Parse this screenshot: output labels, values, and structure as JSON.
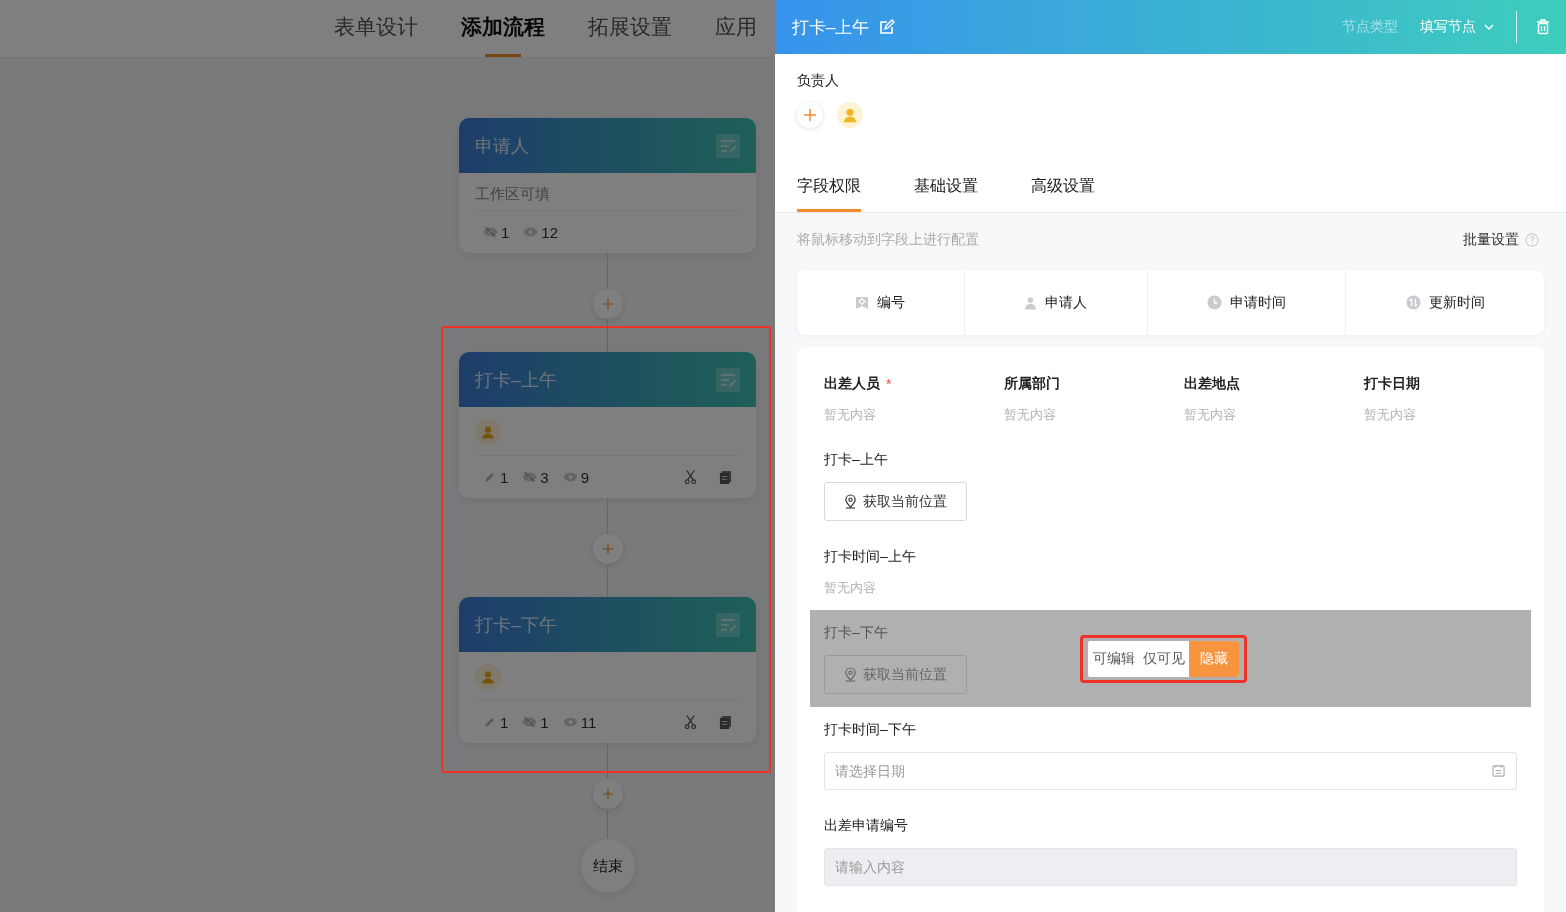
{
  "top_tabs": [
    {
      "label": "表单设计",
      "selected": false
    },
    {
      "label": "添加流程",
      "selected": true
    },
    {
      "label": "拓展设置",
      "selected": false
    },
    {
      "label": "应用",
      "selected": false
    }
  ],
  "flow": {
    "nodes": [
      {
        "kind": "start",
        "title": "申请人",
        "subtitle": "工作区可填",
        "counts": [
          {
            "kind": "hidden",
            "value": "1"
          },
          {
            "kind": "visible",
            "value": "12"
          }
        ]
      },
      {
        "kind": "task",
        "title": "打卡–上午",
        "counts": [
          {
            "kind": "editable",
            "value": "1"
          },
          {
            "kind": "hidden",
            "value": "3"
          },
          {
            "kind": "visible",
            "value": "9"
          }
        ]
      },
      {
        "kind": "task",
        "title": "打卡–下午",
        "counts": [
          {
            "kind": "editable",
            "value": "1"
          },
          {
            "kind": "hidden",
            "value": "1"
          },
          {
            "kind": "visible",
            "value": "11"
          }
        ]
      }
    ],
    "end_label": "结束"
  },
  "drawer": {
    "title": "打卡–上午",
    "node_type_label": "节点类型",
    "node_type": "填写节点",
    "assignee_label": "负责人",
    "tabs": [
      {
        "label": "字段权限",
        "selected": true
      },
      {
        "label": "基础设置",
        "selected": false
      },
      {
        "label": "高级设置",
        "selected": false
      }
    ],
    "hint": "将鼠标移动到字段上进行配置",
    "batch_label": "批量设置",
    "system_fields": [
      {
        "kind": "number",
        "label": "编号"
      },
      {
        "kind": "person",
        "label": "申请人"
      },
      {
        "kind": "created",
        "label": "申请时间"
      },
      {
        "kind": "updated",
        "label": "更新时间"
      }
    ],
    "rows": [
      {
        "hovered": false,
        "fields": [
          {
            "kind": "text",
            "label": "出差人员",
            "required_mark": "*",
            "value": "暂无内容"
          },
          {
            "kind": "text",
            "label": "所属部门",
            "value": "暂无内容"
          },
          {
            "kind": "text",
            "label": "出差地点",
            "value": "暂无内容"
          },
          {
            "kind": "text",
            "label": "打卡日期",
            "value": "暂无内容"
          }
        ]
      },
      {
        "hovered": false,
        "fields": [
          {
            "kind": "location",
            "label": "打卡–上午",
            "button": "获取当前位置"
          }
        ]
      },
      {
        "hovered": false,
        "fields": [
          {
            "kind": "text",
            "label": "打卡时间–上午",
            "value": "暂无内容"
          }
        ]
      },
      {
        "hovered": true,
        "fields": [
          {
            "kind": "location",
            "label": "打卡–下午",
            "button": "获取当前位置"
          }
        ],
        "permissions": [
          {
            "label": "可编辑",
            "selected": false
          },
          {
            "label": "仅可见",
            "selected": false
          },
          {
            "label": "隐藏",
            "selected": true
          }
        ]
      },
      {
        "hovered": false,
        "fields": [
          {
            "kind": "date",
            "label": "打卡时间–下午",
            "placeholder": "请选择日期"
          }
        ]
      },
      {
        "hovered": false,
        "fields": [
          {
            "kind": "input",
            "label": "出差申请编号",
            "placeholder": "请输入内容",
            "disabled": true
          }
        ]
      }
    ]
  }
}
